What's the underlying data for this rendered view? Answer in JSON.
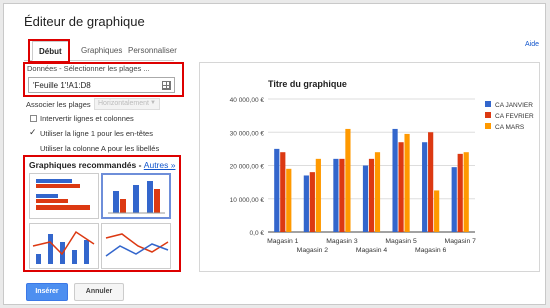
{
  "dialog": {
    "title": "Éditeur de graphique",
    "help": "Aide"
  },
  "tabs": [
    {
      "label": "Début"
    },
    {
      "label": "Graphiques"
    },
    {
      "label": "Personnaliser"
    }
  ],
  "data_section": {
    "label": "Données - Sélectionner les plages ...",
    "range_value": "'Feuille 1'!A1:D8",
    "combine_label": "Associer les plages",
    "combine_select": "Horizontalement",
    "options": [
      {
        "label": "Intervertir lignes et colonnes",
        "checked": false
      },
      {
        "label": "Utiliser la ligne 1 pour les en-têtes",
        "checked": true
      },
      {
        "label": "Utiliser la colonne A pour les libellés",
        "checked": false
      }
    ]
  },
  "recommended": {
    "title": "Graphiques recommandés",
    "sep": " - ",
    "link": "Autres »"
  },
  "buttons": {
    "insert": "Insérer",
    "cancel": "Annuler"
  },
  "colors": {
    "series": [
      "#3366cc",
      "#dc3912",
      "#ff9900"
    ]
  },
  "chart_data": {
    "type": "bar",
    "title": "Titre du graphique",
    "categories": [
      "Magasin 1",
      "Magasin 2",
      "Magasin 3",
      "Magasin 4",
      "Magasin 5",
      "Magasin 6",
      "Magasin 7"
    ],
    "series": [
      {
        "name": "CA JANVIER",
        "values": [
          25000,
          17000,
          22000,
          20000,
          31000,
          27000,
          19500
        ]
      },
      {
        "name": "CA FEVRIER",
        "values": [
          24000,
          18000,
          22000,
          22000,
          27000,
          30000,
          23500
        ]
      },
      {
        "name": "CA MARS",
        "values": [
          19000,
          22000,
          31000,
          24000,
          29500,
          12500,
          24000
        ]
      }
    ],
    "ylim": [
      0,
      40000
    ],
    "yticks": [
      "0,0 €",
      "10 000,00 €",
      "20 000,00 €",
      "30 000,00 €",
      "40 000,00 €"
    ],
    "legend": "right",
    "grid": true
  }
}
